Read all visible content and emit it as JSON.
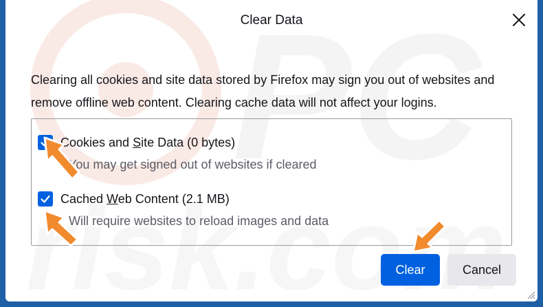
{
  "dialog": {
    "title": "Clear Data",
    "description": "Clearing all cookies and site data stored by Firefox may sign you out of websites and remove offline web content. Clearing cache data will not affect your logins."
  },
  "options": [
    {
      "label_prefix": "Cookies and ",
      "label_access_key": "S",
      "label_suffix": "ite Data (0 bytes)",
      "sublabel": "You may get signed out of websites if cleared",
      "checked": true
    },
    {
      "label_prefix": "Cached ",
      "label_access_key": "W",
      "label_suffix": "eb Content (2.1 MB)",
      "sublabel": "Will require websites to reload images and data",
      "checked": true
    }
  ],
  "buttons": {
    "clear": "Clear",
    "cancel": "Cancel"
  },
  "colors": {
    "accent": "#0061e0",
    "annotation_arrow": "#f28a2e",
    "background_frame": "#1f5fa6"
  },
  "icons": {
    "close": "close-icon",
    "checkbox": "checkmark-icon",
    "arrow": "arrow-annotation-icon"
  }
}
